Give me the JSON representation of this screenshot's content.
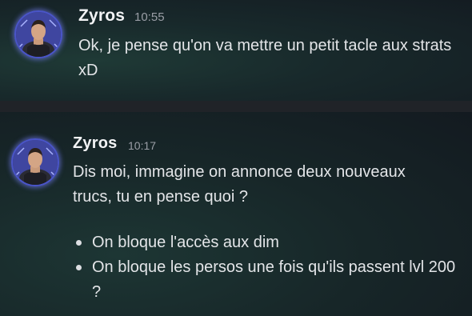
{
  "messages": [
    {
      "username": "Zyros",
      "timestamp": "10:55",
      "text": "Ok, je pense qu'on va mettre un petit tacle aux strats xD",
      "avatar_icon": "user-avatar"
    },
    {
      "username": "Zyros",
      "timestamp": "10:17",
      "text": "Dis moi, immagine on annonce deux nouveaux trucs, tu en pense quoi ?",
      "avatar_icon": "user-avatar",
      "bullets": [
        "On bloque l'accès aux dim",
        "On bloque les persos une fois qu'ils passent lvl 200 ?"
      ]
    }
  ],
  "colors": {
    "username": "#f2f3f5",
    "timestamp": "#9a9ea6",
    "text": "#e3e5e8",
    "avatar_ring": "#4a55c8"
  }
}
